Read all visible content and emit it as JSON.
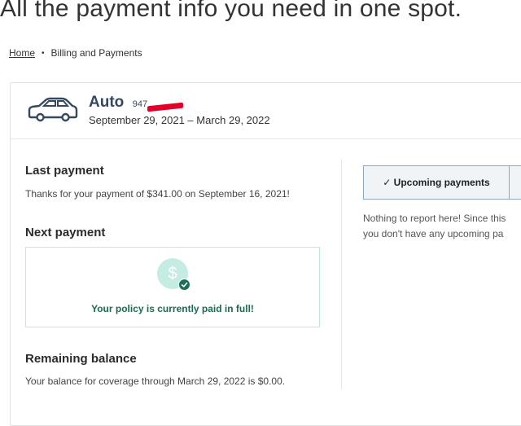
{
  "page": {
    "heading": "All the payment info you need in one spot."
  },
  "breadcrumb": {
    "home": "Home",
    "separator": "•",
    "current": "Billing and Payments"
  },
  "policy": {
    "name": "Auto",
    "number_visible": "947",
    "period": "September 29, 2021 – March 29, 2022",
    "icon": "car-icon"
  },
  "last_payment": {
    "heading": "Last payment",
    "text": "Thanks for your payment of $341.00 on September 16, 2021!"
  },
  "next_payment": {
    "heading": "Next payment",
    "icon_symbol": "$",
    "status": "Your policy is currently paid in full!"
  },
  "remaining_balance": {
    "heading": "Remaining balance",
    "text": "Your balance for coverage through March 29, 2022 is $0.00."
  },
  "upcoming": {
    "tab_label": "✓ Upcoming payments",
    "note_line1": "Nothing to report here! Since this",
    "note_line2": "you don't have any upcoming pa"
  },
  "colors": {
    "accent": "#1a6b52",
    "paid_border": "#b9ebe0",
    "title": "#34495e",
    "redaction": "#e5002a"
  }
}
